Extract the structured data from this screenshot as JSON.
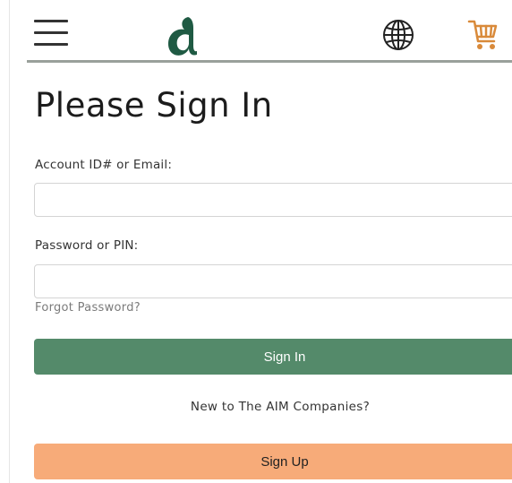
{
  "header": {
    "menu_icon": "hamburger-menu-icon",
    "logo_icon": "aim-logo-icon",
    "globe_icon": "globe-icon",
    "cart_icon": "shopping-cart-icon",
    "brand_color": "#1f5a43",
    "cart_color": "#d98a3a"
  },
  "page": {
    "title": "Please Sign In"
  },
  "form": {
    "account_label": "Account ID# or Email:",
    "account_value": "",
    "password_label": "Password or PIN:",
    "password_value": "",
    "forgot_link": "Forgot Password?",
    "signin_button": "Sign In",
    "signin_color": "#548a6a",
    "new_prompt": "New to The AIM Companies?",
    "signup_button": "Sign Up",
    "signup_color": "#f7ab79"
  }
}
